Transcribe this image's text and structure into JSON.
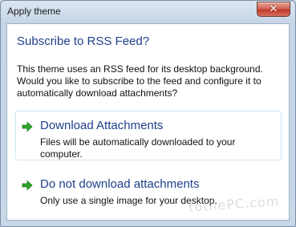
{
  "window": {
    "title": "Apply theme",
    "close_icon": "close-icon",
    "close_symbol": "✕"
  },
  "dialog": {
    "heading": "Subscribe to RSS Feed?",
    "message": "This theme uses an RSS feed for its desktop background. Would you like to subscribe to the feed and configure it to automatically download attachments?",
    "options": [
      {
        "title": "Download Attachments",
        "description": "Files will be automatically downloaded to your computer.",
        "icon": "green-arrow-icon"
      },
      {
        "title": "Do not download attachments",
        "description": "Only use a single image for your desktop.",
        "icon": "green-arrow-icon"
      }
    ]
  },
  "watermark": "tothePC.com",
  "colors": {
    "heading": "#1e3f8a",
    "arrow": "#2aa52a",
    "close_button": "#c0392b"
  }
}
